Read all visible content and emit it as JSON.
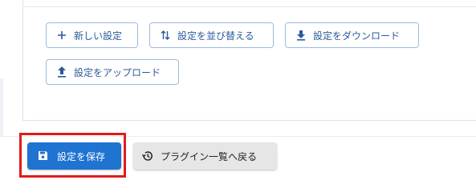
{
  "settings_actions": {
    "new_label": "新しい設定",
    "sort_label": "設定を並び替える",
    "download_label": "設定をダウンロード",
    "upload_label": "設定をアップロード",
    "accent_color": "#2a5b98",
    "border_color": "#9bbbe0",
    "icons": {
      "new": "plus-icon",
      "sort": "sort-arrows-icon",
      "download": "download-icon",
      "upload": "upload-icon"
    }
  },
  "footer": {
    "save_label": "設定を保存",
    "back_label": "プラグイン一覧へ戻る",
    "save_color": "#1f73d1",
    "highlight_color": "#e11b1b",
    "icons": {
      "save": "floppy-disk-icon",
      "back": "history-icon"
    }
  }
}
